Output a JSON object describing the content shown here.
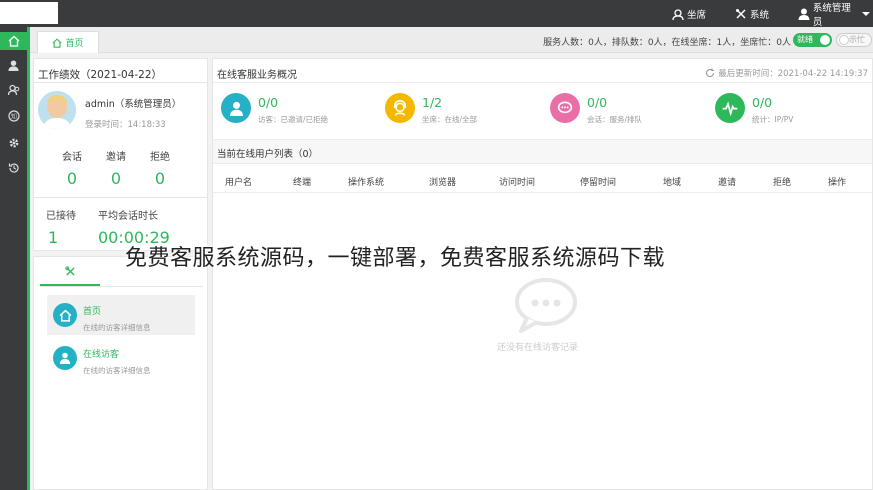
{
  "topbar": {
    "menu": [
      {
        "label": "坐席",
        "icon": "agent-headset-icon"
      },
      {
        "label": "系统",
        "icon": "tools-icon"
      },
      {
        "label": "系统管理员",
        "icon": "user-icon"
      }
    ]
  },
  "leftbar": {
    "items": [
      "home-icon",
      "user-icon",
      "users-icon",
      "knowledge-icon",
      "gear-icon",
      "history-icon"
    ]
  },
  "tabs": {
    "home_label": "首页"
  },
  "stats_bar": {
    "text": "服务人数：0人，排队数：0人，在线坐席：1人，坐席忙：0人",
    "status_online": "就绪",
    "status_busy": "示忙"
  },
  "performance": {
    "title": "工作绩效（2021-04-22）",
    "user_name": "admin（系统管理员）",
    "login_time": "登录时间：14:18:33",
    "stats": [
      {
        "label": "会话",
        "value": "0"
      },
      {
        "label": "邀请",
        "value": "0"
      },
      {
        "label": "拒绝",
        "value": "0"
      }
    ],
    "served_label": "已接待",
    "served_value": "1",
    "avg_label": "平均会话时长",
    "avg_value": "00:00:29"
  },
  "quick": {
    "items": [
      {
        "title": "首页",
        "desc": "在线的访客详细信息"
      },
      {
        "title": "在线访客",
        "desc": "在线的访客详细信息"
      }
    ]
  },
  "overview": {
    "title": "在线客服业务概况",
    "update_time": "最后更新时间：2021-04-22 14:19:37",
    "kpis": [
      {
        "value": "0/0",
        "desc": "访客：已邀请/已拒绝",
        "color": "#26b0c6",
        "icon": "visitor-icon"
      },
      {
        "value": "1/2",
        "desc": "坐席：在线/全部",
        "color": "#f5b800",
        "icon": "agent-icon"
      },
      {
        "value": "0/0",
        "desc": "会话：服务/排队",
        "color": "#ea6fa6",
        "icon": "chat-icon"
      },
      {
        "value": "0/0",
        "desc": "统计：IP/PV",
        "color": "#2eb85c",
        "icon": "pulse-icon"
      }
    ]
  },
  "list": {
    "title": "当前在线用户列表（0）",
    "columns": [
      "用户名",
      "终端",
      "操作系统",
      "浏览器",
      "访问时间",
      "停留时间",
      "地域",
      "邀请",
      "拒绝",
      "操作"
    ],
    "empty_text": "还没有在线访客记录"
  },
  "watermark": "免费客服系统源码，一键部署，免费客服系统源码下载"
}
